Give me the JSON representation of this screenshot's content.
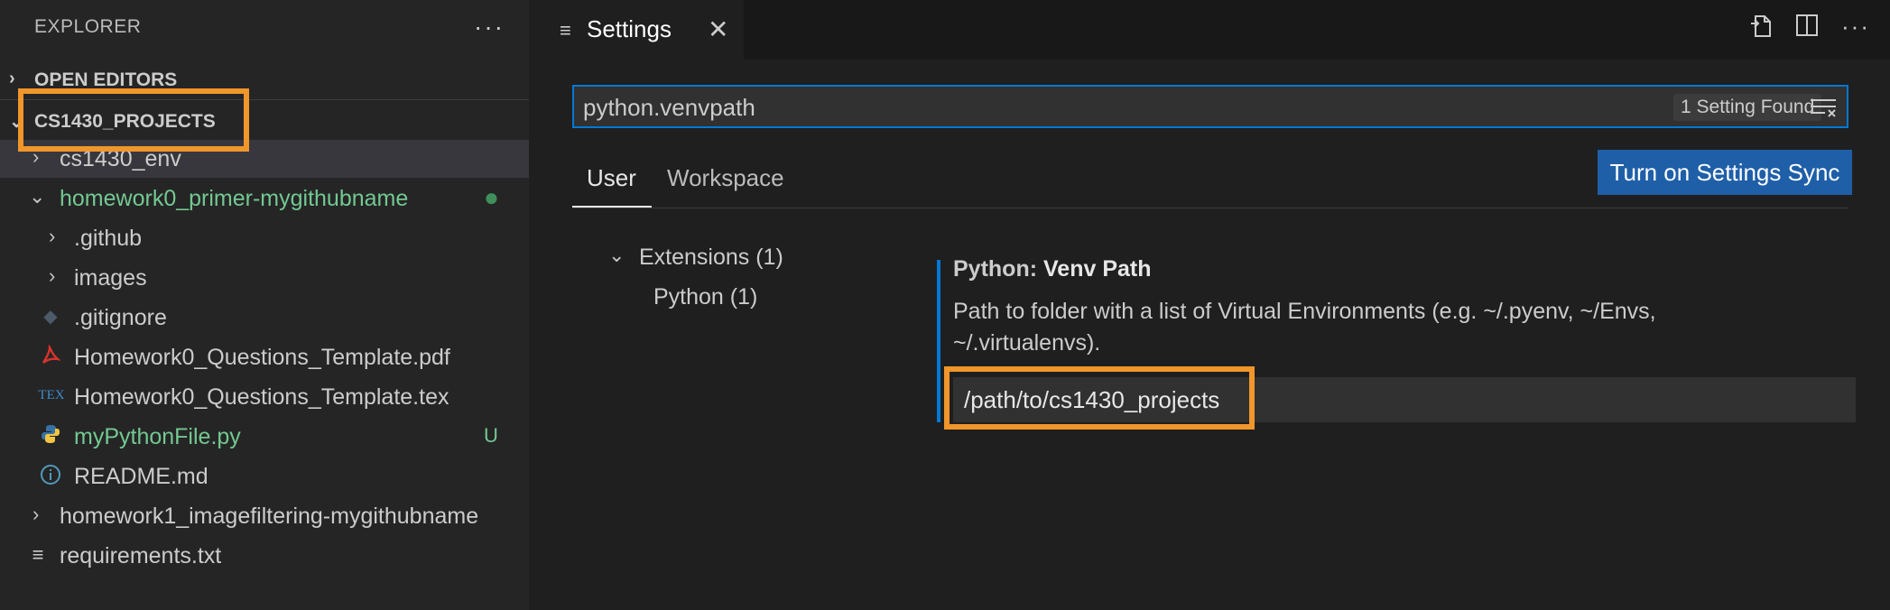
{
  "sidebar": {
    "title": "EXPLORER",
    "more": "···",
    "open_editors": "OPEN EDITORS",
    "project": "CS1430_PROJECTS",
    "tree": [
      {
        "name": "cs1430_env"
      },
      {
        "name": "homework0_primer-mygithubname"
      },
      {
        "name": ".github"
      },
      {
        "name": "images"
      },
      {
        "name": ".gitignore"
      },
      {
        "name": "Homework0_Questions_Template.pdf"
      },
      {
        "name": "Homework0_Questions_Template.tex",
        "icon_text": "TEX"
      },
      {
        "name": "myPythonFile.py",
        "badge": "U"
      },
      {
        "name": "README.md"
      },
      {
        "name": "homework1_imagefiltering-mygithubname"
      },
      {
        "name": "requirements.txt"
      }
    ]
  },
  "tab": {
    "label": "Settings",
    "close": "✕"
  },
  "search": {
    "value": "python.venvpath",
    "result": "1 Setting Found"
  },
  "scopes": {
    "user": "User",
    "workspace": "Workspace"
  },
  "sync_button": "Turn on Settings Sync",
  "toc": {
    "extensions": "Extensions (1)",
    "python": "Python (1)"
  },
  "setting": {
    "category": "Python:",
    "name": "Venv Path",
    "description": "Path to folder with a list of Virtual Environments (e.g. ~/.pyenv, ~/Envs, ~/.virtualenvs).",
    "value": "/path/to/cs1430_projects"
  },
  "colors": {
    "highlight": "#f0962b",
    "accent": "#0078d4",
    "git_untracked": "#73c991"
  }
}
